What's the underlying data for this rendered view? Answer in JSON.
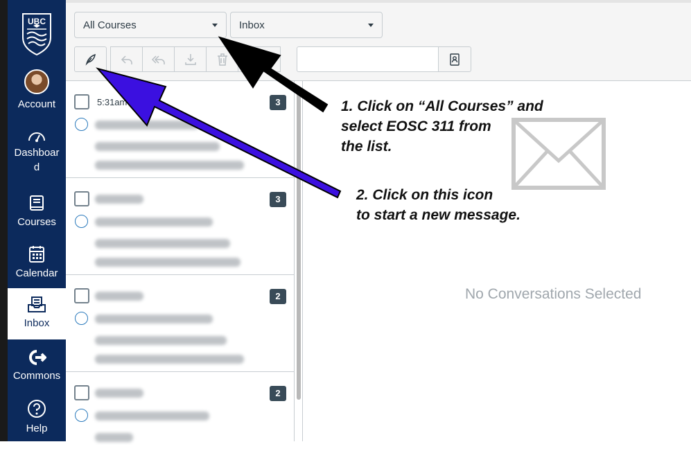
{
  "nav": {
    "logo_text": "UBC",
    "items": [
      {
        "label": "Account",
        "icon": "avatar"
      },
      {
        "label": "Dashboar d",
        "icon": "dashboard-icon"
      },
      {
        "label": "Courses",
        "icon": "courses-icon"
      },
      {
        "label": "Calendar",
        "icon": "calendar-icon"
      },
      {
        "label": "Inbox",
        "icon": "inbox-icon",
        "active": true
      },
      {
        "label": "Commons",
        "icon": "commons-icon"
      },
      {
        "label": "Help",
        "icon": "help-icon"
      }
    ]
  },
  "filters": {
    "course_select": "All Courses",
    "mailbox_select": "Inbox"
  },
  "toolbar": {
    "buttons": [
      "compose-icon",
      "reply-icon",
      "reply-all-icon",
      "archive-icon",
      "delete-icon",
      "more-icon"
    ],
    "search_value": ""
  },
  "conversations": [
    {
      "time": "5:31am",
      "count": "3"
    },
    {
      "time": "",
      "count": "3"
    },
    {
      "time": "",
      "count": "2"
    },
    {
      "time": "",
      "count": "2"
    }
  ],
  "detail": {
    "empty_text": "No Conversations Selected"
  },
  "annotations": {
    "step1": [
      "1. Click on “All Courses” and",
      "select EOSC 311 from",
      "the list."
    ],
    "step2": [
      "2. Click on this icon",
      "to start a new message."
    ]
  },
  "colors": {
    "nav_bg": "#0c2a5c",
    "arrow_blue": "#3b10e0",
    "arrow_black": "#000000",
    "badge": "#394b58"
  }
}
